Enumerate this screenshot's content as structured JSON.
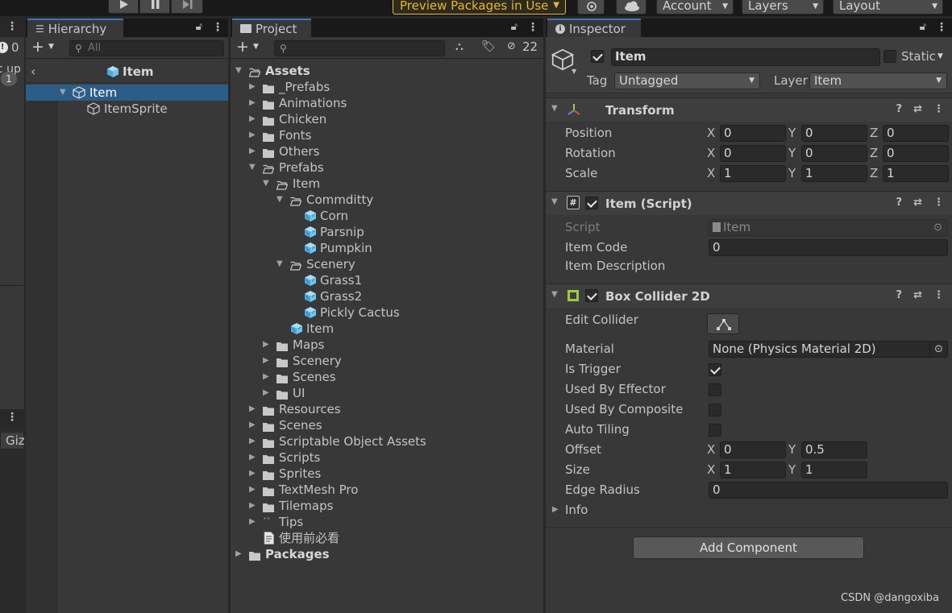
{
  "toolbar": {
    "preview_packages": "Preview Packages in Use",
    "account": "Account",
    "layers": "Layers",
    "layout": "Layout"
  },
  "left_strip": {
    "badge_count": "0",
    "scene_partial": "c up",
    "layer_badge": "1",
    "gizmos_partial": "Giz"
  },
  "hierarchy": {
    "tab": "Hierarchy",
    "search_placeholder": "All",
    "scene_title": "Item",
    "items": [
      {
        "label": "Item",
        "selected": true
      },
      {
        "label": "ItemSprite",
        "selected": false
      }
    ]
  },
  "project": {
    "tab": "Project",
    "hidden_count": "22",
    "tree": [
      {
        "label": "Assets",
        "bold": true
      },
      {
        "label": "_Prefabs"
      },
      {
        "label": "Animations"
      },
      {
        "label": "Chicken"
      },
      {
        "label": "Fonts"
      },
      {
        "label": "Others"
      },
      {
        "label": "Prefabs"
      },
      {
        "label": "Item"
      },
      {
        "label": "Commditty"
      },
      {
        "label": "Corn"
      },
      {
        "label": "Parsnip"
      },
      {
        "label": "Pumpkin"
      },
      {
        "label": "Scenery"
      },
      {
        "label": "Grass1"
      },
      {
        "label": "Grass2"
      },
      {
        "label": "Pickly Cactus"
      },
      {
        "label": "Item"
      },
      {
        "label": "Maps"
      },
      {
        "label": "Scenery"
      },
      {
        "label": "Scenes"
      },
      {
        "label": "UI"
      },
      {
        "label": "Resources"
      },
      {
        "label": "Scenes"
      },
      {
        "label": "Scriptable Object Assets"
      },
      {
        "label": "Scripts"
      },
      {
        "label": "Sprites"
      },
      {
        "label": "TextMesh Pro"
      },
      {
        "label": "Tilemaps"
      },
      {
        "label": "Tips"
      },
      {
        "label": "使用前必看"
      },
      {
        "label": "Packages",
        "bold": true
      }
    ]
  },
  "inspector": {
    "tab": "Inspector",
    "object_name": "Item",
    "static_label": "Static",
    "tag_label": "Tag",
    "tag_value": "Untagged",
    "layer_label": "Layer",
    "layer_value": "Item",
    "transform": {
      "title": "Transform",
      "position_label": "Position",
      "rotation_label": "Rotation",
      "scale_label": "Scale",
      "position": [
        "0",
        "0",
        "0"
      ],
      "rotation": [
        "0",
        "0",
        "0"
      ],
      "scale": [
        "1",
        "1",
        "1"
      ]
    },
    "axes": {
      "x": "X",
      "y": "Y",
      "z": "Z"
    },
    "script": {
      "title": "Item (Script)",
      "script_label": "Script",
      "script_value": "Item",
      "item_code_label": "Item Code",
      "item_code_value": "0",
      "item_description_label": "Item Description"
    },
    "box_collider": {
      "title": "Box Collider 2D",
      "edit_collider_label": "Edit Collider",
      "material_label": "Material",
      "material_value": "None (Physics Material 2D)",
      "is_trigger_label": "Is Trigger",
      "is_trigger": true,
      "used_by_effector_label": "Used By Effector",
      "used_by_composite_label": "Used By Composite",
      "auto_tiling_label": "Auto Tiling",
      "offset_label": "Offset",
      "offset": [
        "0",
        "0.5"
      ],
      "size_label": "Size",
      "size": [
        "1",
        "1"
      ],
      "edge_radius_label": "Edge Radius",
      "edge_radius_value": "0",
      "info_label": "Info"
    },
    "add_component": "Add Component"
  },
  "watermark": "CSDN @dangoxiba",
  "colors": {
    "selection": "#2c5d87",
    "accent_tab": "#3a79bb",
    "preview_yellow": "#e8b72d",
    "prefab_blue": "#6fc3f0",
    "collider_green": "#9ccc41"
  }
}
